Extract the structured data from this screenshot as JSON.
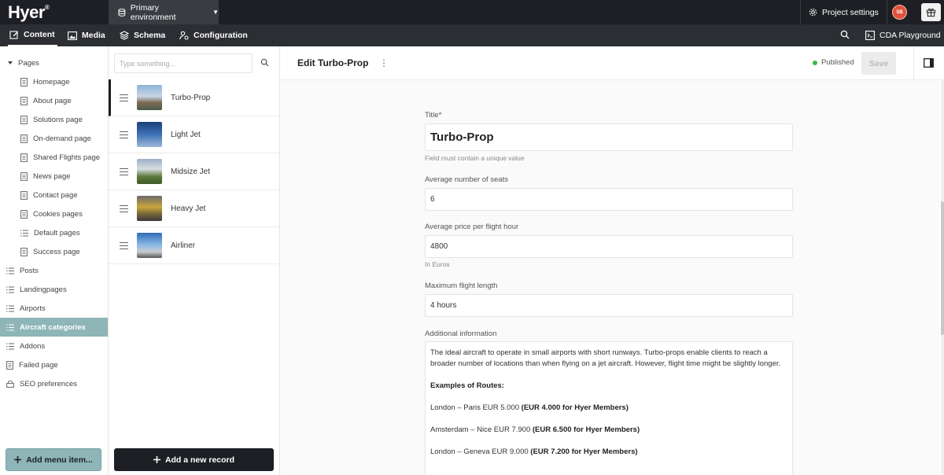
{
  "app": {
    "logo": "Hyer",
    "logo_mark": "®"
  },
  "topbar": {
    "environment": "Primary environment",
    "project_settings": "Project settings",
    "avatar_initials": "SB"
  },
  "nav": {
    "content": "Content",
    "media": "Media",
    "schema": "Schema",
    "configuration": "Configuration",
    "cda": "CDA Playground"
  },
  "sidebar": {
    "items": [
      {
        "label": "Pages"
      },
      {
        "label": "Homepage"
      },
      {
        "label": "About page"
      },
      {
        "label": "Solutions page"
      },
      {
        "label": "On-demand page"
      },
      {
        "label": "Shared Flights page"
      },
      {
        "label": "News page"
      },
      {
        "label": "Contact page"
      },
      {
        "label": "Cookies pages"
      },
      {
        "label": "Default pages"
      },
      {
        "label": "Success page"
      },
      {
        "label": "Posts"
      },
      {
        "label": "Landingpages"
      },
      {
        "label": "Airports"
      },
      {
        "label": "Aircraft categories"
      },
      {
        "label": "Addons"
      },
      {
        "label": "Failed page"
      },
      {
        "label": "SEO preferences"
      }
    ],
    "add_menu_label": "Add menu item..."
  },
  "records": {
    "search_placeholder": "Type something...",
    "items": [
      {
        "label": "Turbo-Prop"
      },
      {
        "label": "Light Jet"
      },
      {
        "label": "Midsize Jet"
      },
      {
        "label": "Heavy Jet"
      },
      {
        "label": "Airliner"
      }
    ],
    "add_label": "Add a new record"
  },
  "editor": {
    "heading": "Edit Turbo-Prop",
    "status": "Published",
    "save_label": "Save",
    "title_label": "Title*",
    "title_value": "Turbo-Prop",
    "title_hint": "Field must contain a unique value",
    "seats_label": "Average number of seats",
    "seats_value": "6",
    "price_label": "Average price per flight hour",
    "price_value": "4800",
    "price_hint": "In Euros",
    "length_label": "Maximum flight length",
    "length_value": "4 hours",
    "info_label": "Additional information",
    "info_text": "The ideal aircraft to operate in small airports with short runways. Turbo-props enable clients to reach a broader number of locations than when flying on a jet aircraft. However, flight time might be slightly longer.",
    "examples_heading": "Examples of Routes:",
    "routes": [
      {
        "route": "London – Paris EUR 5.000 ",
        "member": "(EUR 4.000 for Hyer Members)"
      },
      {
        "route": "Amsterdam – Nice EUR 7.900 ",
        "member": "(EUR 6.500 for Hyer Members)"
      },
      {
        "route": "London – Geneva EUR 9.000 ",
        "member": "(EUR 7.200 for Hyer Members)"
      }
    ]
  },
  "colors": {
    "topbar": "#1d1f24",
    "navbar": "#2c2e33",
    "accent": "#8eb5b7",
    "published": "#3cb44b",
    "avatar": "#e0523c"
  }
}
